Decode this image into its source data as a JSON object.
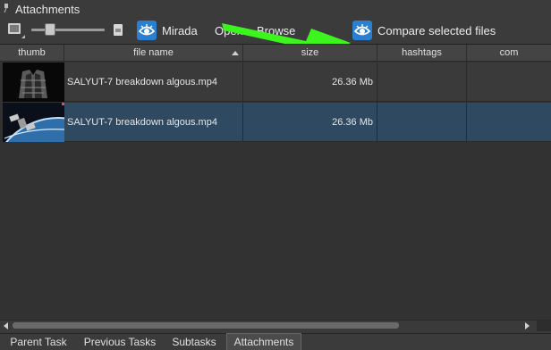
{
  "panel": {
    "title": "Attachments",
    "pin_icon": "pin-icon"
  },
  "toolbar": {
    "size_slider_value": 0.25,
    "mirada_label": "Mirada",
    "open_label": "Open",
    "browse_label": "Browse",
    "compare_label": "Compare selected files",
    "accent_color": "#2b7fd0",
    "annotation_arrow_color": "#3df51e"
  },
  "table": {
    "columns": [
      "thumb",
      "file name",
      "size",
      "hashtags",
      "com"
    ],
    "sort_column": "file name",
    "rows": [
      {
        "thumb": "spaceship-thumbnail",
        "file_name": "SALYUT-7 breakdown algous.mp4",
        "size": "26.36 Mb",
        "hashtags": "",
        "comment": "",
        "selected": false
      },
      {
        "thumb": "earth-orbit-thumbnail",
        "file_name": "SALYUT-7 breakdown algous.mp4",
        "size": "26.36 Mb",
        "hashtags": "",
        "comment": "",
        "selected": true
      }
    ]
  },
  "tabs": [
    {
      "label": "Parent Task",
      "active": false
    },
    {
      "label": "Previous Tasks",
      "active": false
    },
    {
      "label": "Subtasks",
      "active": false
    },
    {
      "label": "Attachments",
      "active": true
    }
  ]
}
